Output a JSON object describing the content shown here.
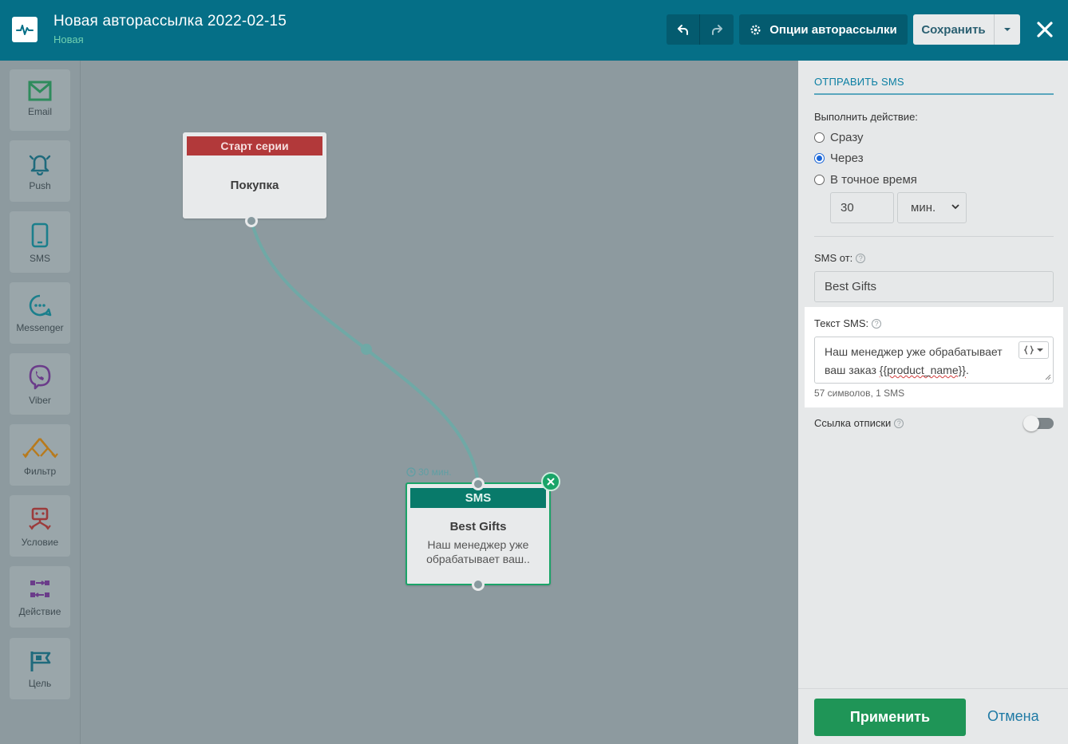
{
  "header": {
    "title": "Новая авторассылка 2022-02-15",
    "status": "Новая",
    "options_label": "Опции авторассылки",
    "save_label": "Сохранить"
  },
  "toolbar": [
    {
      "label": "Email",
      "icon": "envelope-icon",
      "color": "#2e8b5c"
    },
    {
      "label": "Push",
      "icon": "bell-icon",
      "color": "#1f6a7c"
    },
    {
      "label": "SMS",
      "icon": "phone-icon",
      "color": "#1b7f8c"
    },
    {
      "label": "Messenger",
      "icon": "chat-icon",
      "color": "#1b7f8c"
    },
    {
      "label": "Viber",
      "icon": "viber-icon",
      "color": "#6b3c8a"
    },
    {
      "label": "Фильтр",
      "icon": "filter-icon",
      "color": "#b87a1c"
    },
    {
      "label": "Условие",
      "icon": "condition-icon",
      "color": "#9c3b3b"
    },
    {
      "label": "Действие",
      "icon": "action-icon",
      "color": "#6b3c8a"
    },
    {
      "label": "Цель",
      "icon": "flag-icon",
      "color": "#1f6a7c"
    }
  ],
  "canvas": {
    "start_node": {
      "header": "Старт серии",
      "body": "Покупка"
    },
    "sms_node": {
      "header": "SMS",
      "name": "Best Gifts",
      "text": "Наш менеджер уже обрабатывает ваш..",
      "delay": "30 мин."
    }
  },
  "panel": {
    "title": "ОТПРАВИТЬ SMS",
    "action_label": "Выполнить действие:",
    "options": [
      "Сразу",
      "Через",
      "В точное время"
    ],
    "selected_option": "Через",
    "delay_value": "30",
    "delay_unit": "мин.",
    "sms_from_label": "SMS от:",
    "sms_from_value": "Best Gifts",
    "sms_text_label": "Текст SMS:",
    "sms_text_prefix": "Наш менеджер уже обрабатывает ваш заказ ",
    "sms_text_placeholder": "{{product_name}}",
    "sms_text_suffix": ".",
    "char_count": "57 символов, 1 SMS",
    "unsubscribe_label": "Ссылка отписки",
    "apply_label": "Применить",
    "cancel_label": "Отмена"
  },
  "colors": {
    "header_bg": "#056f87",
    "apply_bg": "#1f9557",
    "start_bar": "#b2393a",
    "sms_bar": "#087a6a"
  }
}
